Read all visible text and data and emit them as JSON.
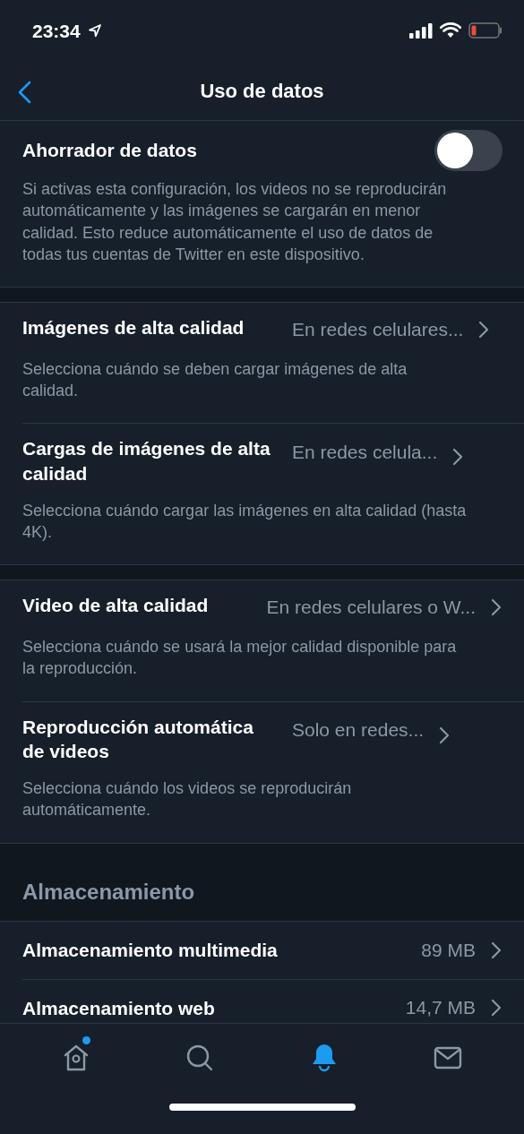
{
  "status_bar": {
    "time": "23:34"
  },
  "nav": {
    "title": "Uso de datos"
  },
  "data_saver": {
    "label": "Ahorrador de datos",
    "on": false,
    "description": "Si activas esta configuración, los videos no se reproducirán automáticamente y las imágenes se cargarán en menor calidad. Esto reduce automáticamente el uso de datos de todas tus cuentas de Twitter en este dispositivo."
  },
  "sections": [
    {
      "items": [
        {
          "label": "Imágenes de alta calidad",
          "value": "En redes celulares...",
          "description": "Selecciona cuándo se deben cargar imágenes de alta calidad."
        },
        {
          "label": "Cargas de imágenes de alta calidad",
          "value": "En redes celula...",
          "description": "Selecciona cuándo cargar las imágenes en alta calidad (hasta 4K)."
        }
      ]
    },
    {
      "items": [
        {
          "label": "Video de alta calidad",
          "value": "En redes celulares o W...",
          "description": "Selecciona cuándo se usará la mejor calidad disponible para la reproducción."
        },
        {
          "label": "Reproducción automática de videos",
          "value": "Solo en redes...",
          "description": "Selecciona cuándo los videos se reproducirán automáticamente."
        }
      ]
    }
  ],
  "storage": {
    "header": "Almacenamiento",
    "items": [
      {
        "label": "Almacenamiento multimedia",
        "value": "89 MB"
      },
      {
        "label": "Almacenamiento web",
        "value": "14,7 MB"
      }
    ]
  },
  "tab_bar": [
    {
      "kind": "home",
      "selected": false,
      "unread": true
    },
    {
      "kind": "search",
      "selected": false,
      "unread": false
    },
    {
      "kind": "notifications",
      "selected": true,
      "unread": false
    },
    {
      "kind": "messages",
      "selected": false,
      "unread": false
    }
  ]
}
